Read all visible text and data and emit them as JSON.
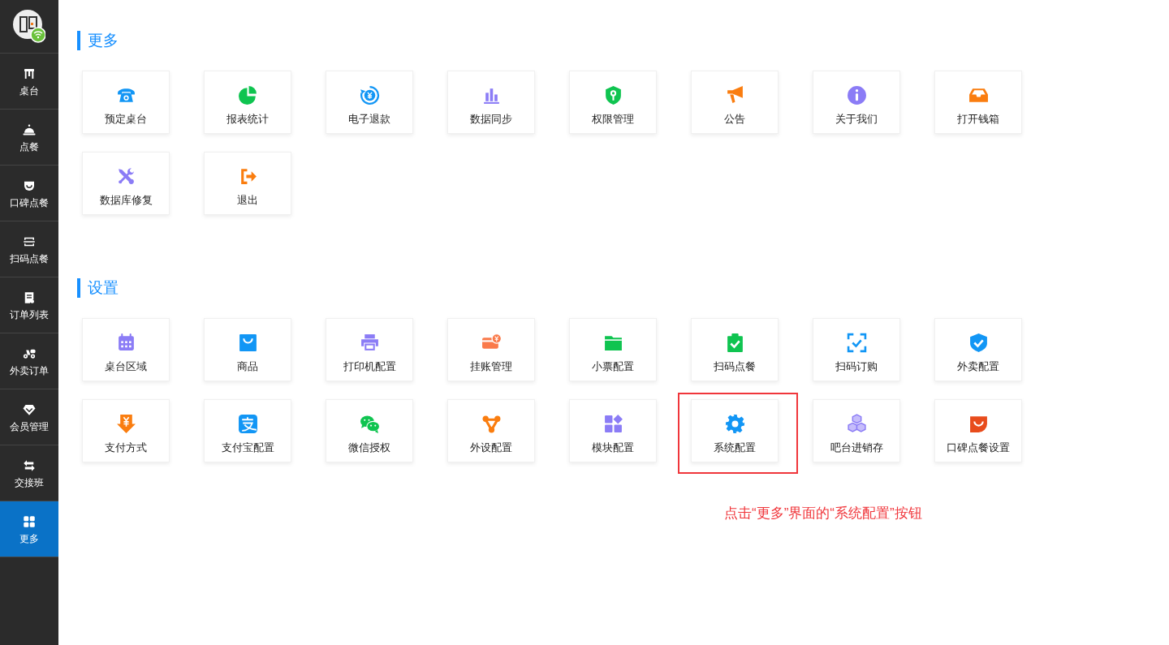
{
  "sidebar": {
    "items": [
      {
        "label": "桌台",
        "selected": false
      },
      {
        "label": "点餐",
        "selected": false
      },
      {
        "label": "口碑点餐",
        "selected": false
      },
      {
        "label": "扫码点餐",
        "selected": false
      },
      {
        "label": "订单列表",
        "selected": false
      },
      {
        "label": "外卖订单",
        "selected": false
      },
      {
        "label": "会员管理",
        "selected": false
      },
      {
        "label": "交接班",
        "selected": false
      },
      {
        "label": "更多",
        "selected": true
      }
    ]
  },
  "sections": [
    {
      "title": "更多",
      "tiles": [
        {
          "label": "预定桌台",
          "highlighted": false
        },
        {
          "label": "报表统计",
          "highlighted": false
        },
        {
          "label": "电子退款",
          "highlighted": false
        },
        {
          "label": "数据同步",
          "highlighted": false
        },
        {
          "label": "权限管理",
          "highlighted": false
        },
        {
          "label": "公告",
          "highlighted": false
        },
        {
          "label": "关于我们",
          "highlighted": false
        },
        {
          "label": "打开钱箱",
          "highlighted": false
        },
        {
          "label": "数据库修复",
          "highlighted": false
        },
        {
          "label": "退出",
          "highlighted": false
        }
      ]
    },
    {
      "title": "设置",
      "tiles": [
        {
          "label": "桌台区域",
          "highlighted": false
        },
        {
          "label": "商品",
          "highlighted": false
        },
        {
          "label": "打印机配置",
          "highlighted": false
        },
        {
          "label": "挂账管理",
          "highlighted": false
        },
        {
          "label": "小票配置",
          "highlighted": false
        },
        {
          "label": "扫码点餐",
          "highlighted": false
        },
        {
          "label": "扫码订购",
          "highlighted": false
        },
        {
          "label": "外卖配置",
          "highlighted": false
        },
        {
          "label": "支付方式",
          "highlighted": false
        },
        {
          "label": "支付宝配置",
          "highlighted": false
        },
        {
          "label": "微信授权",
          "highlighted": false
        },
        {
          "label": "外设配置",
          "highlighted": false
        },
        {
          "label": "模块配置",
          "highlighted": false
        },
        {
          "label": "系统配置",
          "highlighted": true
        },
        {
          "label": "吧台进销存",
          "highlighted": false
        },
        {
          "label": "口碑点餐设置",
          "highlighted": false
        }
      ]
    }
  ],
  "annotation": {
    "text": "点击“更多”界面的“系统配置”按钮"
  }
}
